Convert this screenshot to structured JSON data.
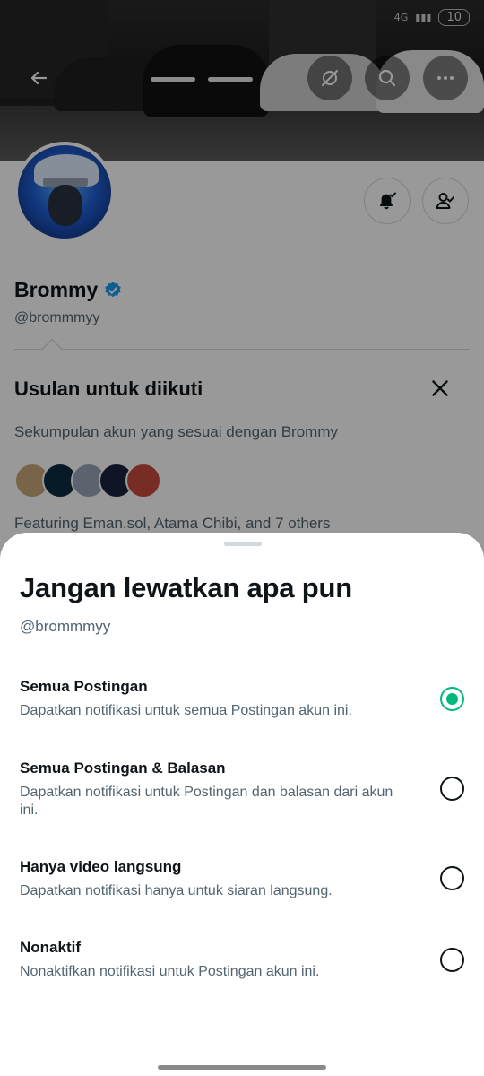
{
  "status_bar": {
    "network": "4G",
    "battery": "10"
  },
  "profile": {
    "display_name": "Brommy",
    "handle": "@brommmyy"
  },
  "suggestions": {
    "title": "Usulan untuk diikuti",
    "description": "Sekumpulan akun yang sesuai dengan Brommy",
    "featuring": "Featuring Eman.sol, Atama Chibi, and 7 others",
    "avatar_colors": [
      "#c9a97a",
      "#0d2c44",
      "#9aa3b8",
      "#1b2440",
      "#c94b3c"
    ]
  },
  "sheet": {
    "title": "Jangan lewatkan apa pun",
    "handle": "@brommmyy",
    "options": [
      {
        "title": "Semua Postingan",
        "desc": "Dapatkan notifikasi untuk semua Postingan akun ini.",
        "selected": true
      },
      {
        "title": "Semua Postingan & Balasan",
        "desc": "Dapatkan notifikasi untuk Postingan dan balasan dari akun ini.",
        "selected": false
      },
      {
        "title": "Hanya video langsung",
        "desc": "Dapatkan notifikasi hanya untuk siaran langsung.",
        "selected": false
      },
      {
        "title": "Nonaktif",
        "desc": "Nonaktifkan notifikasi untuk Postingan akun ini.",
        "selected": false
      }
    ]
  },
  "colors": {
    "accent_green": "#00ba7c",
    "verified_blue": "#1d9bf0",
    "text_primary": "#0f1419",
    "text_secondary": "#536471"
  },
  "icons": {
    "back": "arrow-left-icon",
    "grok": "grok-icon",
    "search": "search-icon",
    "more": "more-icon",
    "notifications": "bell-check-icon",
    "following": "person-check-icon",
    "close": "close-icon",
    "verified": "verified-badge-icon"
  }
}
